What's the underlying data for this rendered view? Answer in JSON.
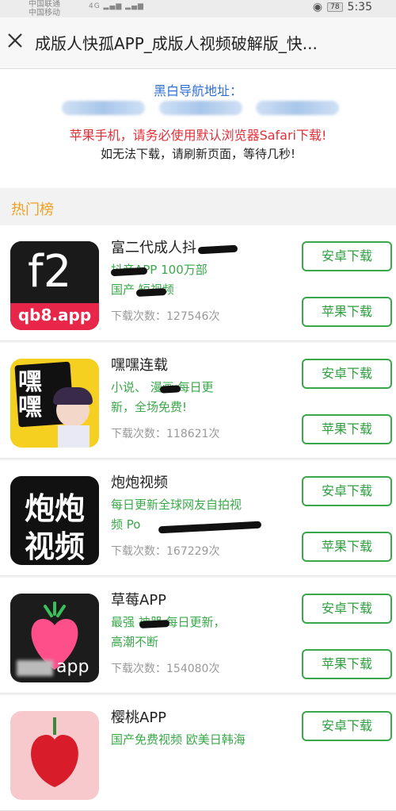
{
  "statusbar": {
    "carrier_line1": "中国联通",
    "carrier_line2": "中国移动",
    "signal": "4G ▂▄▆ ▂▄▆",
    "battery": "78",
    "time": "5:35"
  },
  "titlebar": {
    "title": "成版人快孤APP_成版人视频破解版_快..."
  },
  "notice": {
    "nav_title": "黑白导航地址：",
    "safari_warning": "苹果手机，请务必使用默认浏览器Safari下载!",
    "refresh_tip": "如无法下载，请刷新页面，等待几秒!"
  },
  "section": {
    "title": "热门榜"
  },
  "buttons": {
    "android": "安卓下载",
    "apple": "苹果下载"
  },
  "apps": [
    {
      "name": "富二代成人抖",
      "desc_line1": "    抖音APP 100万部",
      "desc_line2": "国产   短视频",
      "count": "下载次数：127546次",
      "icon_text_top": "f2",
      "icon_text_bottom": "qb8.app"
    },
    {
      "name": "嘿嘿连载",
      "desc_line1": " 小说、   漫画 每日更",
      "desc_line2": "新，全场免费!",
      "count": "下载次数：118621次",
      "icon_text": "嘿嘿"
    },
    {
      "name": "炮炮视频",
      "desc_line1": "每日更新全球网友自拍视",
      "desc_line2": "频 Po",
      "count": "下载次数：167229次",
      "icon_text_top": "炮炮",
      "icon_text_bottom": "视频"
    },
    {
      "name": "草莓APP",
      "desc_line1": "最强   神器 每日更新，",
      "desc_line2": "高潮不断",
      "count": "下载次数：154080次",
      "icon_text": "app"
    },
    {
      "name": "樱桃APP",
      "desc_line1": "国产免费视频 欧美日韩海",
      "desc_line2": "",
      "count": "",
      "icon_text": ""
    }
  ],
  "colors": {
    "accent_green": "#3aa84a",
    "link_blue": "#2e6fd6",
    "warning_red": "#e0303a",
    "section_orange": "#f0a020"
  }
}
